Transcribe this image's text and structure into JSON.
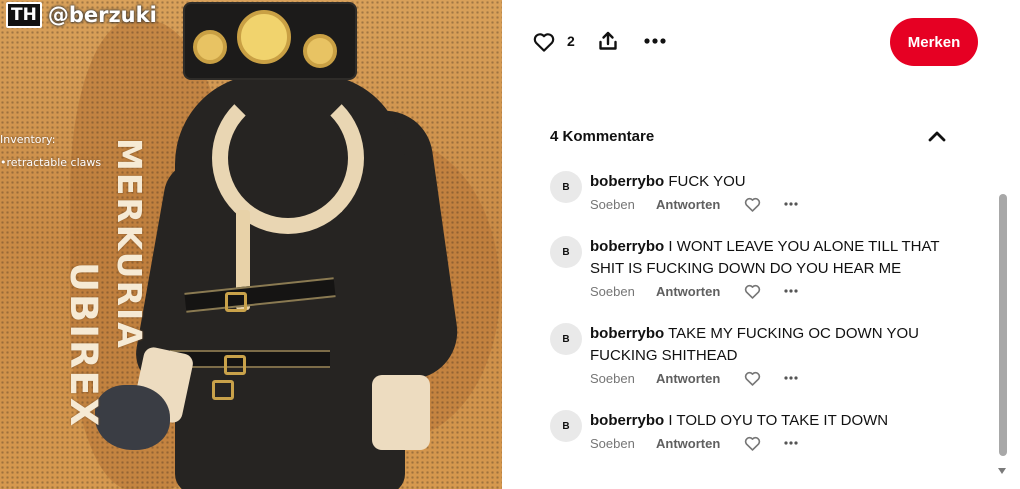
{
  "artwork": {
    "badge": "TH",
    "handle": "@berzuki",
    "inventory_title": "Inventory:",
    "inventory_item": "•retractable claws",
    "name_line1": "MERKURIA",
    "name_line2": "UBIREX"
  },
  "actions": {
    "like_icon": "heart-outline-icon",
    "like_count": "2",
    "share_icon": "share-upload-icon",
    "more_icon": "more-horizontal-icon",
    "save_label": "Merken",
    "save_color": "#e60023"
  },
  "comments_section": {
    "count_label": "4 Kommentare",
    "collapse_icon": "chevron-up-icon",
    "comments": [
      {
        "avatar_initial": "B",
        "username": "boberrybo",
        "text": "FUCK YOU",
        "time": "Soeben",
        "reply_label": "Antworten"
      },
      {
        "avatar_initial": "B",
        "username": "boberrybo",
        "text": "I WONT LEAVE YOU ALONE TILL THAT SHIT IS FUCKING DOWN DO YOU HEAR ME",
        "time": "Soeben",
        "reply_label": "Antworten"
      },
      {
        "avatar_initial": "B",
        "username": "boberrybo",
        "text": "TAKE MY FUCKING OC DOWN YOU FUCKING SHITHEAD",
        "time": "Soeben",
        "reply_label": "Antworten"
      },
      {
        "avatar_initial": "B",
        "username": "boberrybo",
        "text": "I TOLD OYU TO TAKE IT DOWN",
        "time": "Soeben",
        "reply_label": "Antworten"
      }
    ]
  }
}
